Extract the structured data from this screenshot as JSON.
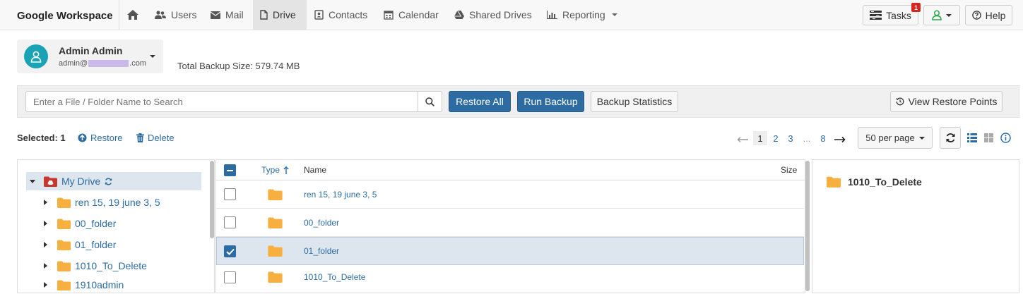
{
  "brand": "Google Workspace",
  "nav": [
    {
      "label": "",
      "icon": "home-icon"
    },
    {
      "label": "Users",
      "icon": "users-icon"
    },
    {
      "label": "Mail",
      "icon": "envelope-icon"
    },
    {
      "label": "Drive",
      "icon": "file-icon",
      "active": true
    },
    {
      "label": "Contacts",
      "icon": "contact-card-icon"
    },
    {
      "label": "Calendar",
      "icon": "calendar-icon"
    },
    {
      "label": "Shared Drives",
      "icon": "google-drive-icon"
    },
    {
      "label": "Reporting",
      "icon": "bar-chart-icon"
    }
  ],
  "top_right": {
    "tasks_label": "Tasks",
    "tasks_badge": "1",
    "help_label": "Help"
  },
  "user": {
    "name": "Admin Admin",
    "email_prefix": "admin@",
    "email_suffix": ".com"
  },
  "backup_size": "Total Backup Size: 579.74 MB",
  "toolbar": {
    "search_placeholder": "Enter a File / Folder Name to Search",
    "restore_all": "Restore All",
    "run_backup": "Run Backup",
    "backup_statistics": "Backup Statistics",
    "view_restore_points": "View Restore Points"
  },
  "selection": {
    "selected_label": "Selected: 1",
    "restore": "Restore",
    "delete": "Delete"
  },
  "pagination": {
    "pages": [
      "1",
      "2",
      "3",
      "...",
      "8"
    ],
    "current": "1",
    "per_page": "50 per page"
  },
  "tree": {
    "root": "My Drive",
    "items": [
      "ren 15, 19 june 3, 5",
      "00_folder",
      "01_folder",
      "1010_To_Delete",
      "1910admin"
    ]
  },
  "table": {
    "headers": {
      "type": "Type",
      "name": "Name",
      "size": "Size"
    },
    "rows": [
      {
        "name": "ren 15, 19 june 3, 5",
        "checked": false
      },
      {
        "name": "00_folder",
        "checked": false
      },
      {
        "name": "01_folder",
        "checked": true
      },
      {
        "name": "1010_To_Delete",
        "checked": false
      }
    ]
  },
  "detail": {
    "name": "1010_To_Delete"
  },
  "colors": {
    "accent": "#2d6ca2",
    "folder": "#f7b040",
    "avatar": "#1aa3b5"
  }
}
